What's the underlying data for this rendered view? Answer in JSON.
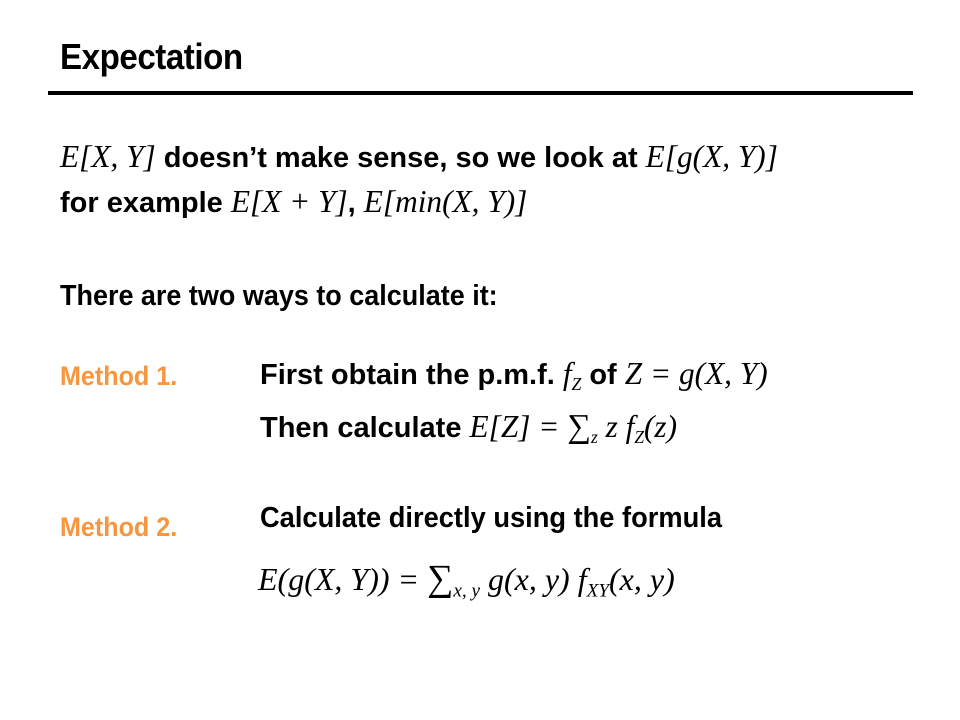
{
  "slide": {
    "title": "Expectation",
    "intro": {
      "line1": {
        "math_a": "E[X, Y]",
        "text": " doesn’t make sense, so we look at ",
        "math_b": "E[g(X, Y)]"
      },
      "line2": {
        "text": "for example ",
        "math_a": "E[X + Y]",
        "sep": ", ",
        "math_b": "E[min(X, Y)]"
      }
    },
    "ways_text": "There are two ways to calculate it:",
    "method1": {
      "label": "Method 1.",
      "step1_text": "First obtain the p.m.f. ",
      "step1_f": "f",
      "step1_sub": "Z",
      "step1_of": " of ",
      "step1_math": "Z = g(X, Y)",
      "step2_text": "Then calculate ",
      "step2_lhs": "E[Z] = ",
      "step2_sigma": "∑",
      "step2_sigma_sub": "z",
      "step2_z": " z ",
      "step2_f": "f",
      "step2_f_sub": "Z",
      "step2_arg": "(z)"
    },
    "method2": {
      "label": "Method 2.",
      "step1_text": "Calculate directly using the formula",
      "formula_lhs": "E(g(X, Y)) = ",
      "formula_sigma": "∑",
      "formula_sigma_sub": "x, y",
      "formula_g": " g(x, y) ",
      "formula_f": "f",
      "formula_f_sub": "XY",
      "formula_arg": "(x, y)"
    },
    "colors": {
      "accent": "#f7963e",
      "text": "#000000",
      "background": "#ffffff"
    }
  }
}
